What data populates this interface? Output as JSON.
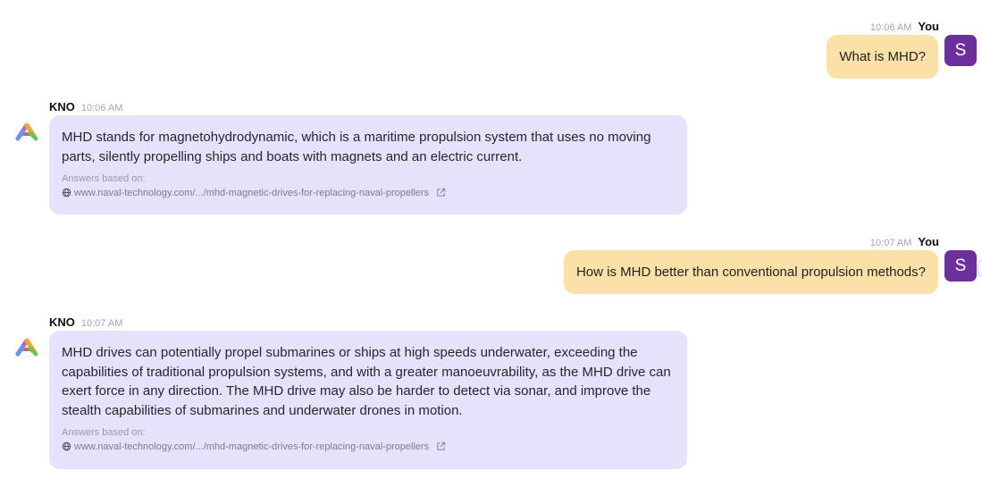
{
  "messages": [
    {
      "role": "user",
      "time": "10:06 AM",
      "sender": "You",
      "text": "What is MHD?",
      "avatar_letter": "S"
    },
    {
      "role": "bot",
      "time": "10:06 AM",
      "sender": "KNO",
      "text": "MHD stands for magnetohydrodynamic, which is a maritime propulsion system that uses no moving parts, silently propelling ships and boats with magnets and an electric current.",
      "sources_label": "Answers based on:",
      "source_url": "www.naval-technology.com/.../mhd-magnetic-drives-for-replacing-naval-propellers"
    },
    {
      "role": "user",
      "time": "10:07 AM",
      "sender": "You",
      "text": "How is MHD better than conventional propulsion methods?",
      "avatar_letter": "S"
    },
    {
      "role": "bot",
      "time": "10:07 AM",
      "sender": "KNO",
      "text": "MHD drives can potentially propel submarines or ships at high speeds underwater, exceeding the capabilities of traditional propulsion systems, and with a greater manoeuvrability, as the MHD drive can exert force in any direction. The MHD drive may also be harder to detect via sonar, and improve the stealth capabilities of submarines and underwater drones in motion.",
      "sources_label": "Answers based on:",
      "source_url": "www.naval-technology.com/.../mhd-magnetic-drives-for-replacing-naval-propellers"
    }
  ],
  "colors": {
    "user_bubble": "#fbe1a8",
    "bot_bubble": "#e6e2fb",
    "avatar": "#6d2f9e"
  },
  "icons": {
    "bot_logo": "kno-logo-icon",
    "source_globe": "globe-icon",
    "source_open": "external-link-icon"
  }
}
